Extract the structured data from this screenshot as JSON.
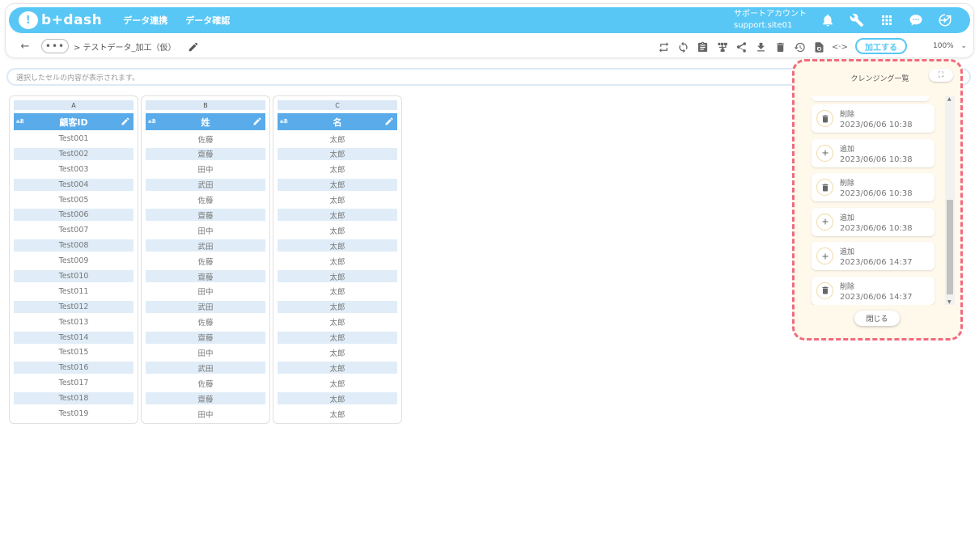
{
  "header": {
    "logo_text": "b+dash",
    "nav": [
      "データ連携",
      "データ確認"
    ],
    "account_name": "サポートアカウント",
    "account_site": "support.site01",
    "icons": [
      "bell-icon",
      "wrench-icon",
      "grid-icon",
      "chat-icon",
      "logout-icon"
    ],
    "accent_color": "#58c7f5"
  },
  "breadcrumb": {
    "more": "•••",
    "current": "> テストデータ_加工（仮）"
  },
  "toolbar": {
    "icons": [
      "swap-icon",
      "refresh-icon",
      "clipboard-icon",
      "hierarchy-icon",
      "share-icon",
      "download-icon",
      "trash-icon",
      "history-icon",
      "file-refresh-icon",
      "code-icon"
    ],
    "process_label": "加工する",
    "zoom": "100%"
  },
  "cellbar": {
    "placeholder": "選択したセルの内容が表示されます。"
  },
  "columns": [
    {
      "letter": "A",
      "type_badge": "aあ",
      "name": "顧客ID",
      "values": [
        "Test001",
        "Test002",
        "Test003",
        "Test004",
        "Test005",
        "Test006",
        "Test007",
        "Test008",
        "Test009",
        "Test010",
        "Test011",
        "Test012",
        "Test013",
        "Test014",
        "Test015",
        "Test016",
        "Test017",
        "Test018",
        "Test019"
      ]
    },
    {
      "letter": "B",
      "type_badge": "aあ",
      "name": "姓",
      "values": [
        "佐藤",
        "齋藤",
        "田中",
        "武田",
        "佐藤",
        "齋藤",
        "田中",
        "武田",
        "佐藤",
        "齋藤",
        "田中",
        "武田",
        "佐藤",
        "齋藤",
        "田中",
        "武田",
        "佐藤",
        "齋藤",
        "田中"
      ]
    },
    {
      "letter": "C",
      "type_badge": "aあ",
      "name": "名",
      "values": [
        "太郎",
        "太郎",
        "太郎",
        "太郎",
        "太郎",
        "太郎",
        "太郎",
        "太郎",
        "太郎",
        "太郎",
        "太郎",
        "太郎",
        "太郎",
        "太郎",
        "太郎",
        "太郎",
        "太郎",
        "太郎",
        "太郎"
      ]
    }
  ],
  "cleansing_panel": {
    "title": "クレンジング一覧",
    "expand_icon": "⛶",
    "items": [
      {
        "action": "削除",
        "timestamp": "2023/06/06 10:38",
        "icon": "trash-icon"
      },
      {
        "action": "追加",
        "timestamp": "2023/06/06 10:38",
        "icon": "plus-icon"
      },
      {
        "action": "削除",
        "timestamp": "2023/06/06 10:38",
        "icon": "trash-icon"
      },
      {
        "action": "追加",
        "timestamp": "2023/06/06 10:38",
        "icon": "plus-icon"
      },
      {
        "action": "追加",
        "timestamp": "2023/06/06 14:37",
        "icon": "plus-icon"
      },
      {
        "action": "削除",
        "timestamp": "2023/06/06 14:37",
        "icon": "trash-icon"
      }
    ],
    "close_label": "閉じる",
    "highlight_color": "#f26a7e"
  }
}
